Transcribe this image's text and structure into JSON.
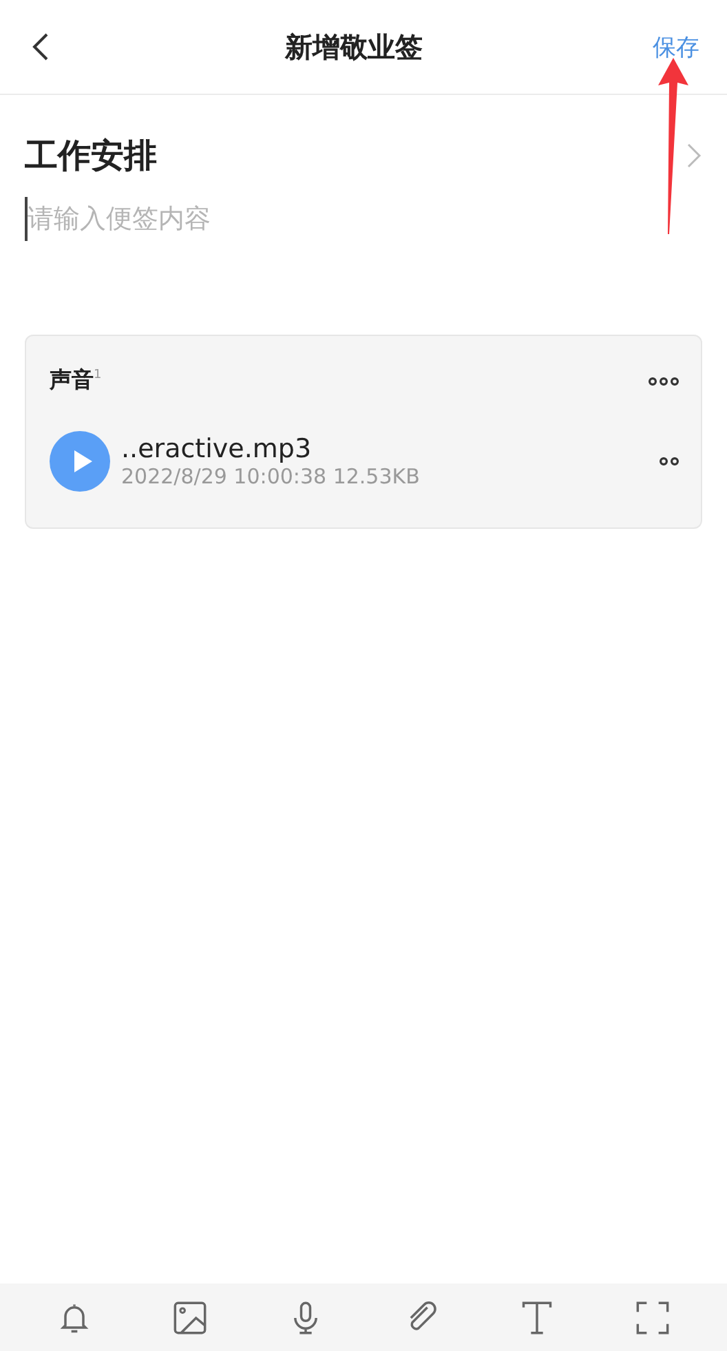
{
  "header": {
    "title": "新增敬业签",
    "save": "保存"
  },
  "note": {
    "title": "工作安排",
    "placeholder": "请输入便签内容"
  },
  "attachment_card": {
    "heading": "声音$^{1}$",
    "files": [
      {
        "name": "..eractive.mp3",
        "meta": "2022/8/29 10:00:38 12.53KB"
      }
    ]
  },
  "toolbar": [
    {
      "kind": "bell"
    },
    {
      "kind": "image"
    },
    {
      "kind": "mic"
    },
    {
      "kind": "clip"
    },
    {
      "kind": "text"
    },
    {
      "kind": "expand"
    }
  ]
}
